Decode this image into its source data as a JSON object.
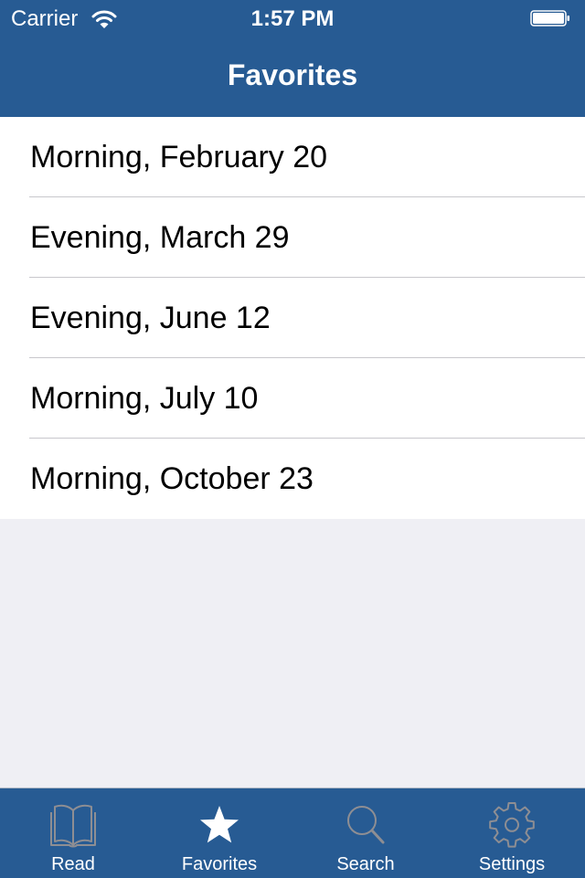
{
  "status_bar": {
    "carrier": "Carrier",
    "time": "1:57 PM",
    "wifi_icon": "wifi-icon",
    "battery_icon": "battery-full-icon"
  },
  "nav": {
    "title": "Favorites"
  },
  "favorites": [
    {
      "label": "Morning, February 20"
    },
    {
      "label": "Evening, March 29"
    },
    {
      "label": "Evening, June 12"
    },
    {
      "label": "Morning, July 10"
    },
    {
      "label": "Morning, October 23"
    }
  ],
  "tabbar": {
    "tabs": [
      {
        "label": "Read",
        "icon": "book-icon",
        "selected": false
      },
      {
        "label": "Favorites",
        "icon": "star-icon",
        "selected": true
      },
      {
        "label": "Search",
        "icon": "search-icon",
        "selected": false
      },
      {
        "label": "Settings",
        "icon": "gear-icon",
        "selected": false
      }
    ]
  },
  "colors": {
    "brand": "#275B93",
    "background": "#EFEFF4",
    "separator": "#C8C7CC",
    "tab_icon_inactive": "#8E8E93",
    "tab_icon_active": "#FFFFFF"
  }
}
